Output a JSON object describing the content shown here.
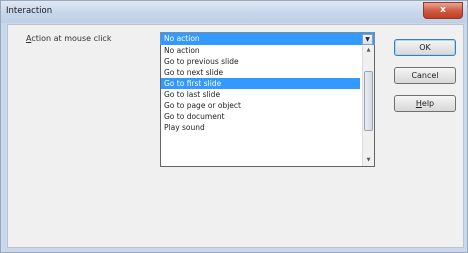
{
  "window": {
    "title": "Interaction",
    "close_glyph": "x"
  },
  "form": {
    "action_label_accel": "A",
    "action_label_rest": "ction at mouse click",
    "combo_value": "No action",
    "combo_arrow": "▼"
  },
  "list": {
    "items": [
      "No action",
      "Go to previous slide",
      "Go to next slide",
      "Go to first slide",
      "Go to last slide",
      "Go to page or object",
      "Go to document",
      "Play sound"
    ],
    "selected_index": 3
  },
  "scroll": {
    "up": "▲",
    "down": "▼"
  },
  "buttons": {
    "ok": "OK",
    "cancel": "Cancel",
    "help_accel": "H",
    "help_rest": "elp"
  }
}
